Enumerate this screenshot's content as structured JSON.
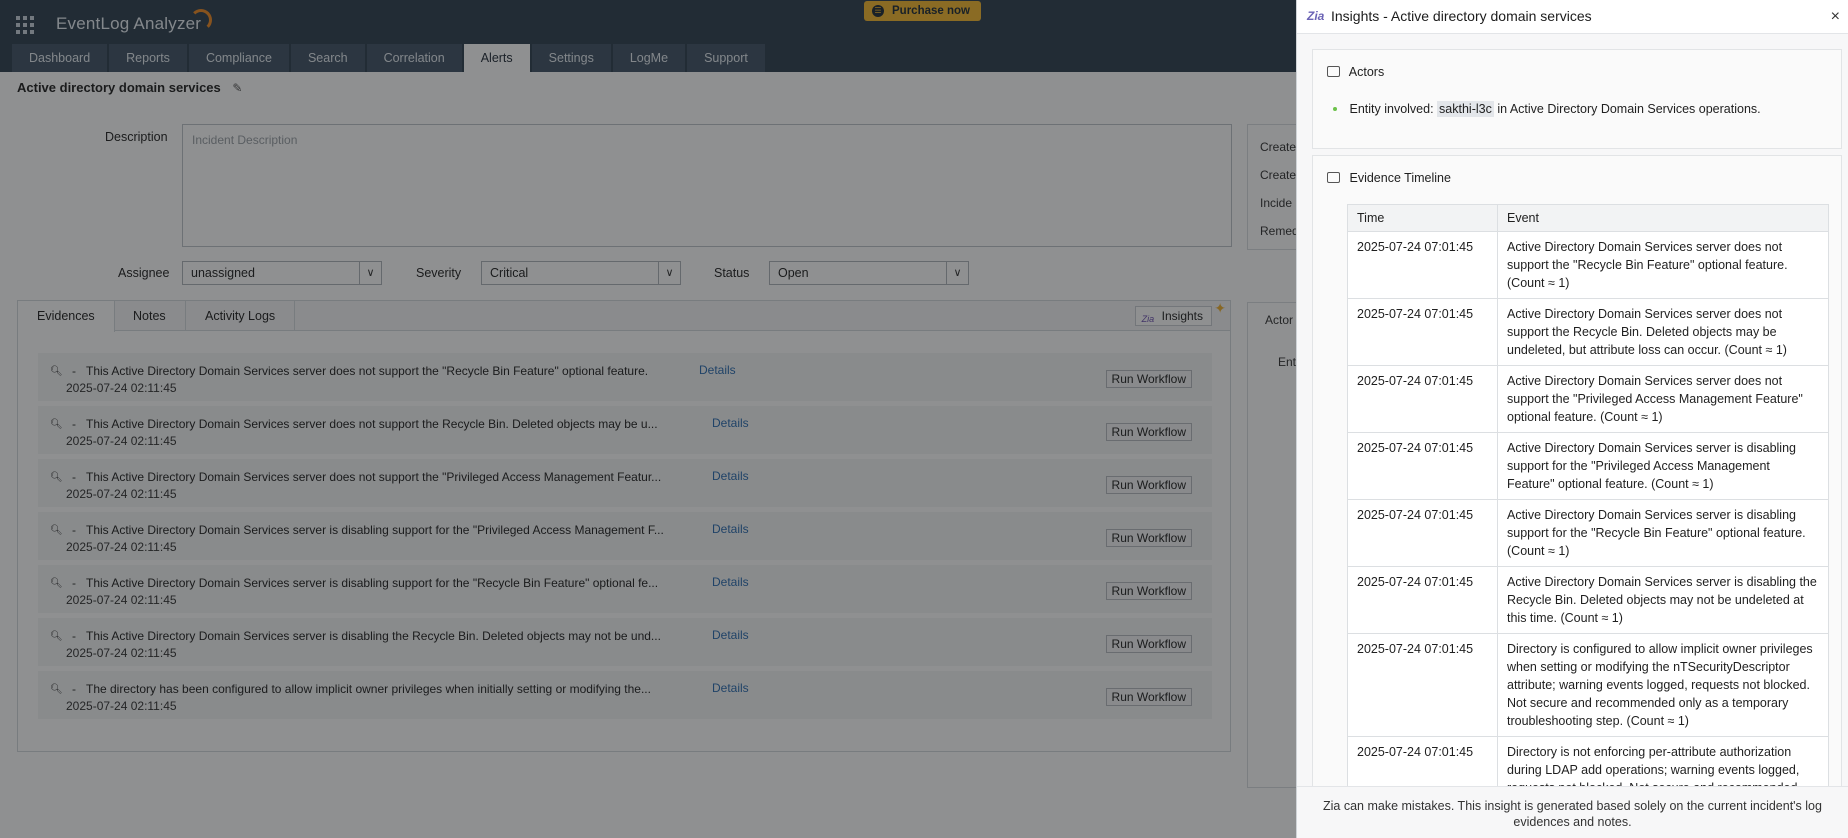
{
  "app": {
    "logo": "EventLog Analyzer",
    "purchase_label": "Purchase now",
    "tabs": [
      "Dashboard",
      "Reports",
      "Compliance",
      "Search",
      "Correlation",
      "Alerts",
      "Settings",
      "LogMe",
      "Support"
    ],
    "active_tab": "Alerts"
  },
  "incident": {
    "title": "Active directory domain services",
    "description_label": "Description",
    "description_placeholder": "Incident Description",
    "assignee_label": "Assignee",
    "assignee_value": "unassigned",
    "severity_label": "Severity",
    "severity_value": "Critical",
    "status_label": "Status",
    "status_value": "Open",
    "side_labels": [
      "Create",
      "Create",
      "Incide",
      "Remed"
    ],
    "side_labels2": [
      "Actor",
      "Ent"
    ]
  },
  "evidence_panel": {
    "tabs": [
      "Evidences",
      "Notes",
      "Activity Logs"
    ],
    "insights_button": "Insights",
    "details_label": "Details",
    "run_label": "Run Workflow",
    "rows": [
      {
        "message": "This Active Directory Domain Services server does not support the \"Recycle Bin Feature\" optional feature.",
        "time": "2025-07-24 02:11:45"
      },
      {
        "message": "This Active Directory Domain Services server does not support the Recycle Bin. Deleted objects may be u...",
        "time": "2025-07-24 02:11:45"
      },
      {
        "message": "This Active Directory Domain Services server does not support the \"Privileged Access Management Featur...",
        "time": "2025-07-24 02:11:45"
      },
      {
        "message": "This Active Directory Domain Services server is disabling support for the \"Privileged Access Management F...",
        "time": "2025-07-24 02:11:45"
      },
      {
        "message": "This Active Directory Domain Services server is disabling support for the \"Recycle Bin Feature\" optional fe...",
        "time": "2025-07-24 02:11:45"
      },
      {
        "message": "This Active Directory Domain Services server is disabling the Recycle Bin. Deleted objects may not be und...",
        "time": "2025-07-24 02:11:45"
      },
      {
        "message": "The directory has been configured to allow implicit owner privileges when initially setting or modifying the...",
        "time": "2025-07-24 02:11:45"
      }
    ]
  },
  "insights": {
    "title": "Insights - Active directory domain services",
    "close": "×",
    "actors_heading": "Actors",
    "entity_prefix": "Entity involved:",
    "entity_name": "sakthi-l3c",
    "entity_suffix": "in Active Directory Domain Services operations.",
    "timeline_heading": "Evidence Timeline",
    "col_time": "Time",
    "col_event": "Event",
    "timeline": [
      {
        "time": "2025-07-24 07:01:45",
        "event": "Active Directory Domain Services server does not support the \"Recycle Bin Feature\" optional feature. (Count ≈ 1)"
      },
      {
        "time": "2025-07-24 07:01:45",
        "event": "Active Directory Domain Services server does not support the Recycle Bin. Deleted objects may be undeleted, but attribute loss can occur. (Count ≈ 1)"
      },
      {
        "time": "2025-07-24 07:01:45",
        "event": "Active Directory Domain Services server does not support the \"Privileged Access Management Feature\" optional feature. (Count ≈ 1)"
      },
      {
        "time": "2025-07-24 07:01:45",
        "event": "Active Directory Domain Services server is disabling support for the \"Privileged Access Management Feature\" optional feature. (Count ≈ 1)"
      },
      {
        "time": "2025-07-24 07:01:45",
        "event": "Active Directory Domain Services server is disabling support for the \"Recycle Bin Feature\" optional feature. (Count ≈ 1)"
      },
      {
        "time": "2025-07-24 07:01:45",
        "event": "Active Directory Domain Services server is disabling the Recycle Bin. Deleted objects may not be undeleted at this time. (Count ≈ 1)"
      },
      {
        "time": "2025-07-24 07:01:45",
        "event": "Directory is configured to allow implicit owner privileges when setting or modifying the nTSecurityDescriptor attribute; warning events logged, requests not blocked. Not secure and recommended only as a temporary troubleshooting step. (Count ≈ 1)"
      },
      {
        "time": "2025-07-24 07:01:45",
        "event": "Directory is not enforcing per-attribute authorization during LDAP add operations; warning events logged, requests not blocked. Not secure and recommended"
      }
    ],
    "disclaimer_line1": "Zia can make mistakes. This insight is generated based solely on the current incident's log",
    "disclaimer_line2": "evidences and notes."
  }
}
